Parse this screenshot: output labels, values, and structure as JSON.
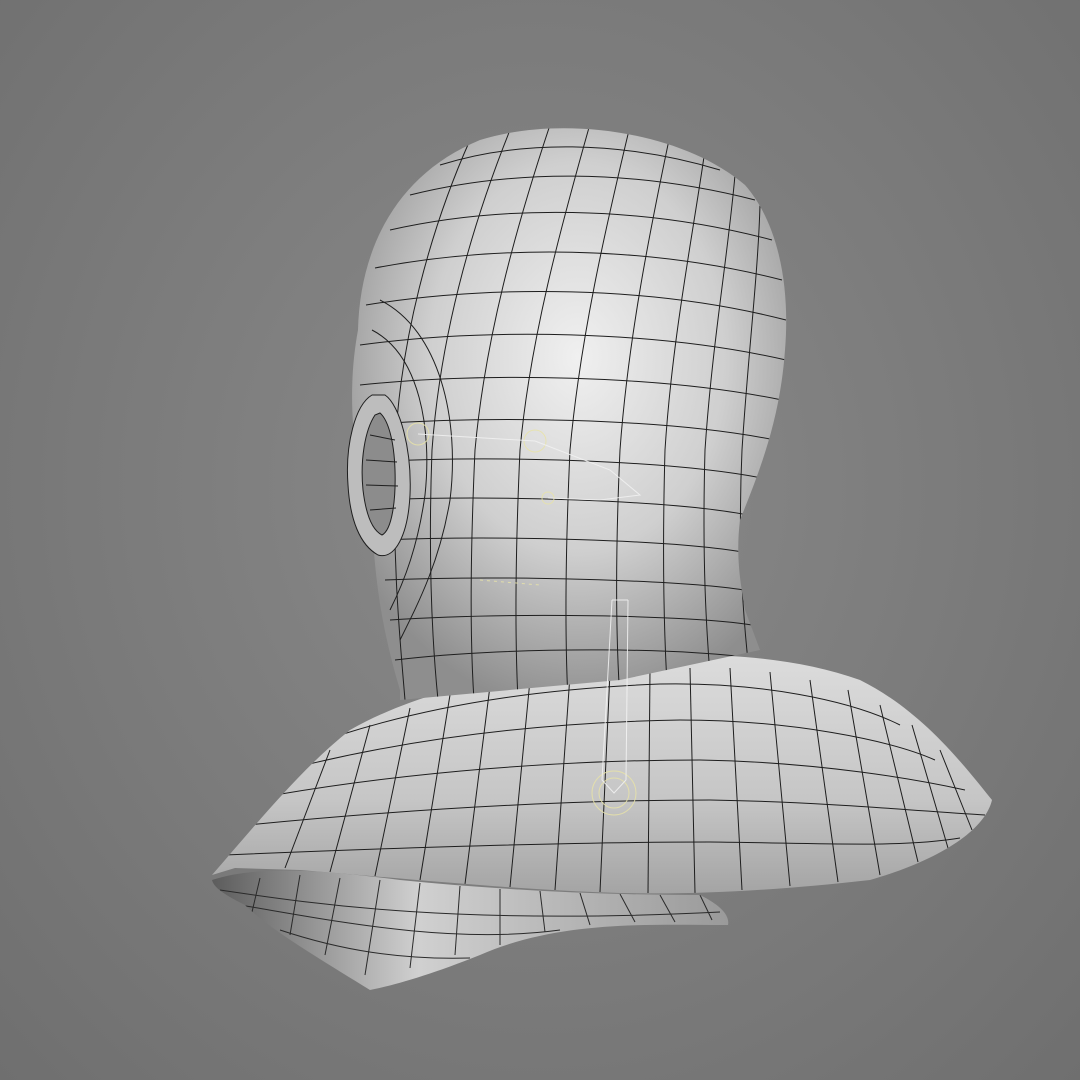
{
  "viewport": {
    "background_color": "#7c7c7c",
    "model": {
      "subject": "head-and-shoulders-bust",
      "display_mode": "wireframe-on-shaded",
      "surface_color": "#d4d4d4",
      "wire_color": "#1e1e1e",
      "rig_overlay_color": "#e8e3a8"
    }
  }
}
